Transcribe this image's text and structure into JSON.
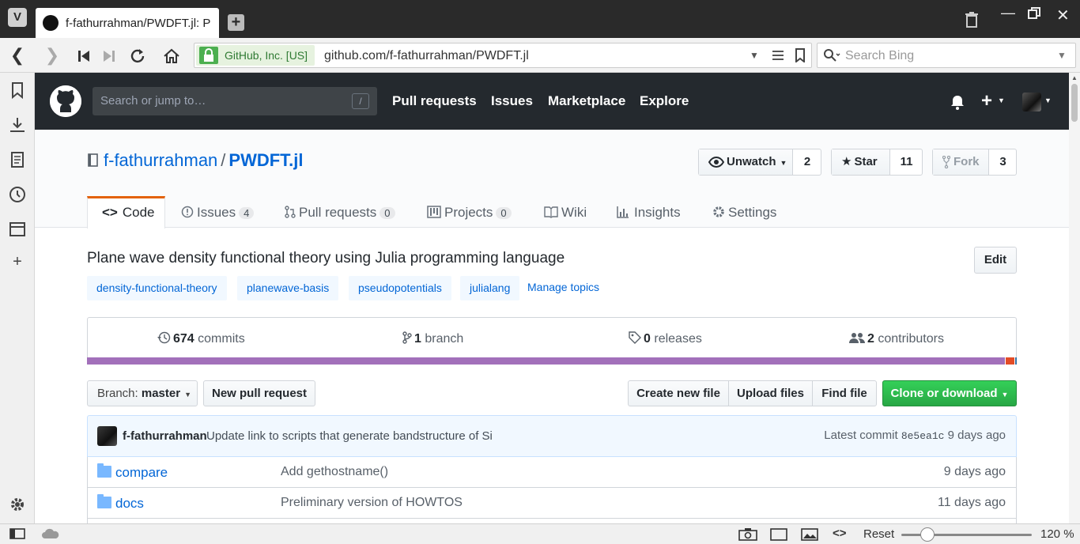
{
  "browser": {
    "tab_title": "f-fathurrahman/PWDFT.jl: P",
    "security_label": "GitHub, Inc. [US]",
    "url": "github.com/f-fathurrahman/PWDFT.jl",
    "search_placeholder": "Search Bing",
    "status": {
      "reset_label": "Reset",
      "zoom": "120 %",
      "zoom_level": 0.2
    }
  },
  "github": {
    "search_placeholder": "Search or jump to…",
    "search_key": "/",
    "nav": [
      "Pull requests",
      "Issues",
      "Marketplace",
      "Explore"
    ]
  },
  "repo": {
    "owner": "f-fathurrahman",
    "separator": "/",
    "name": "PWDFT.jl",
    "watch": {
      "label": "Unwatch",
      "count": "2"
    },
    "star": {
      "label": "Star",
      "count": "11"
    },
    "fork": {
      "label": "Fork",
      "count": "3"
    },
    "tabs": [
      {
        "label": "Code",
        "counter": ""
      },
      {
        "label": "Issues",
        "counter": "4"
      },
      {
        "label": "Pull requests",
        "counter": "0"
      },
      {
        "label": "Projects",
        "counter": "0"
      },
      {
        "label": "Wiki",
        "counter": ""
      },
      {
        "label": "Insights",
        "counter": ""
      },
      {
        "label": "Settings",
        "counter": ""
      }
    ],
    "description": "Plane wave density functional theory using Julia programming language",
    "edit_label": "Edit",
    "topics": [
      "density-functional-theory",
      "planewave-basis",
      "pseudopotentials",
      "julialang"
    ],
    "manage_topics": "Manage topics",
    "summary": {
      "commits_count": "674",
      "commits_label": "commits",
      "branch_count": "1",
      "branch_label": "branch",
      "releases_count": "0",
      "releases_label": "releases",
      "contributors_count": "2",
      "contributors_label": "contributors"
    },
    "languages": [
      {
        "color": "#a270ba",
        "share": 0.989
      },
      {
        "color": "#e34c26",
        "share": 0.009
      },
      {
        "color": "#3572A5",
        "share": 0.002
      }
    ],
    "branch_prefix": "Branch:",
    "branch_name": "master",
    "new_pull_request": "New pull request",
    "create_new_file": "Create new file",
    "upload_files": "Upload files",
    "find_file": "Find file",
    "clone_or_download": "Clone or download",
    "latest_commit": {
      "author": "f-fathurrahman",
      "message": "Update link to scripts that generate bandstructure of Si",
      "prefix": "Latest commit",
      "sha": "8e5ea1c",
      "age": "9 days ago"
    },
    "files": [
      {
        "name": "compare",
        "message": "Add gethostname()",
        "age": "9 days ago"
      },
      {
        "name": "docs",
        "message": "Preliminary version of HOWTOS",
        "age": "11 days ago"
      }
    ]
  }
}
